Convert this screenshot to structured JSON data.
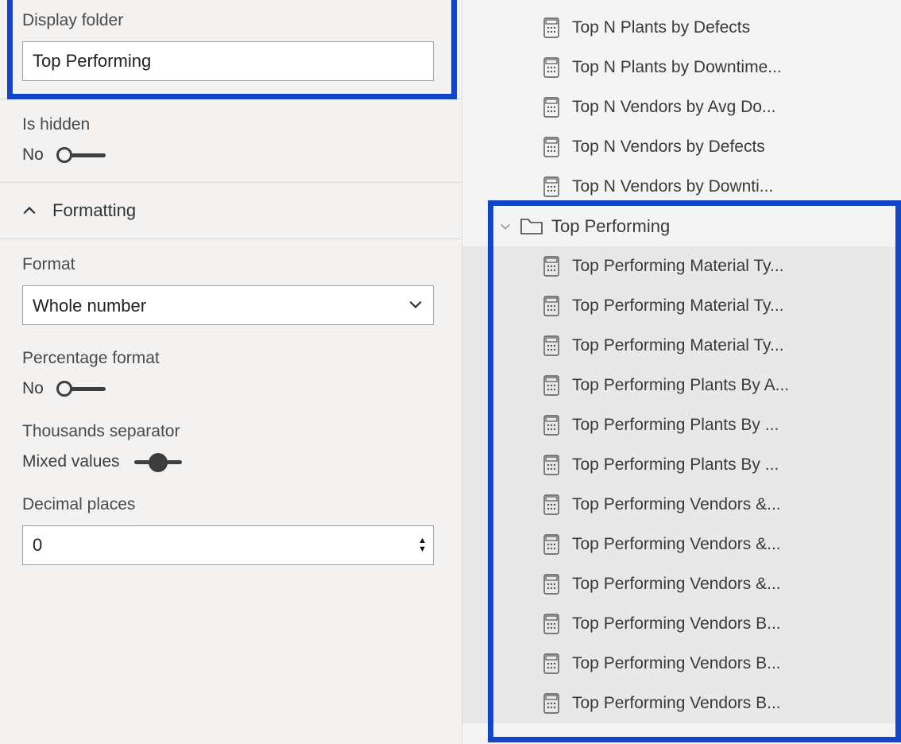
{
  "properties": {
    "display_folder": {
      "label": "Display folder",
      "value": "Top Performing"
    },
    "is_hidden": {
      "label": "Is hidden",
      "value_text": "No",
      "state": "off"
    },
    "formatting_header": "Formatting",
    "format": {
      "label": "Format",
      "value": "Whole number"
    },
    "percentage_format": {
      "label": "Percentage format",
      "value_text": "No",
      "state": "off"
    },
    "thousands_separator": {
      "label": "Thousands separator",
      "value_text": "Mixed values",
      "state": "mid"
    },
    "decimal_places": {
      "label": "Decimal places",
      "value": "0"
    }
  },
  "fields": {
    "top_measures": [
      "Top N Plants by Defects",
      "Top N Plants by Downtime...",
      "Top N Vendors by Avg Do...",
      "Top N Vendors by Defects",
      "Top N Vendors by Downti..."
    ],
    "folder": {
      "name": "Top Performing",
      "items": [
        "Top Performing Material Ty...",
        "Top Performing Material Ty...",
        "Top Performing Material Ty...",
        "Top Performing Plants By A...",
        "Top Performing Plants By ...",
        "Top Performing Plants By ...",
        "Top Performing Vendors &...",
        "Top Performing Vendors &...",
        "Top Performing Vendors &...",
        "Top Performing Vendors B...",
        "Top Performing Vendors B...",
        "Top Performing Vendors B..."
      ]
    }
  }
}
